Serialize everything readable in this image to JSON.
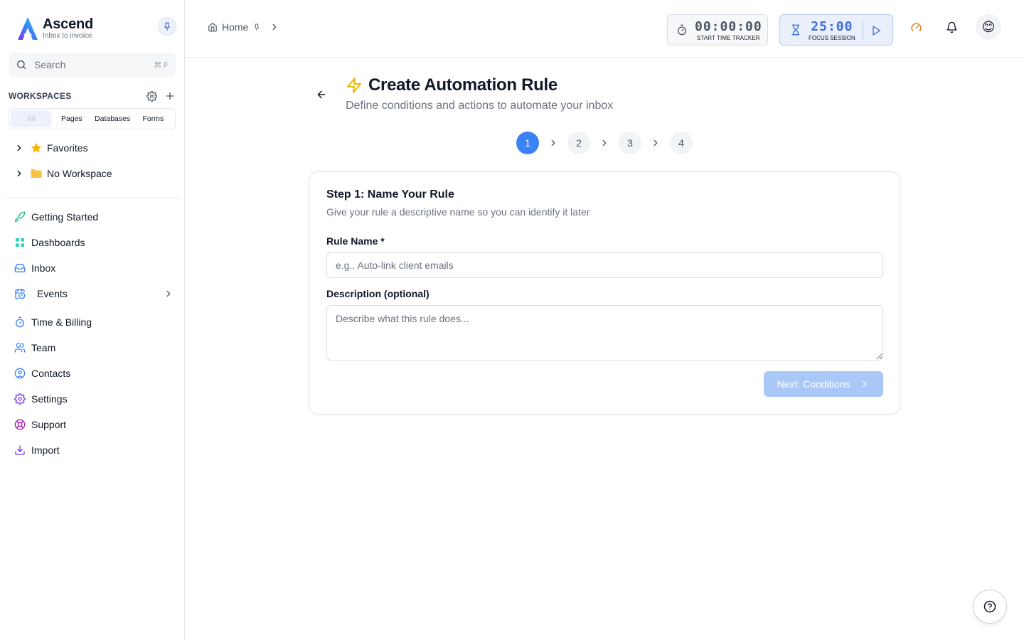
{
  "brand": {
    "name": "Ascend",
    "tagline": "Inbox to invoice"
  },
  "search": {
    "label": "Search",
    "shortcut": "⌘ F"
  },
  "workspaces": {
    "title": "WORKSPACES",
    "tabs": [
      "All",
      "Pages",
      "Databases",
      "Forms"
    ],
    "active_tab": "All",
    "tree": [
      {
        "label": "Favorites",
        "icon": "star-icon"
      },
      {
        "label": "No Workspace",
        "icon": "folder-icon"
      }
    ]
  },
  "nav": [
    {
      "label": "Getting Started",
      "icon": "rocket-icon"
    },
    {
      "label": "Dashboards",
      "icon": "dashboard-grid-icon"
    },
    {
      "label": "Inbox",
      "icon": "inbox-icon"
    },
    {
      "label": "Events",
      "icon": "calendar-clock-icon"
    },
    {
      "label": "Time & Billing",
      "icon": "stopwatch-icon"
    },
    {
      "label": "Team",
      "icon": "team-icon"
    },
    {
      "label": "Contacts",
      "icon": "contact-icon"
    },
    {
      "label": "Settings",
      "icon": "gear-icon"
    },
    {
      "label": "Support",
      "icon": "support-icon"
    },
    {
      "label": "Import",
      "icon": "download-icon"
    }
  ],
  "breadcrumb": {
    "home": "Home"
  },
  "tracker": {
    "time": "00:00:00",
    "label": "START TIME TRACKER"
  },
  "focus": {
    "time": "25:00",
    "label": "FOCUS SESSION"
  },
  "avatar": {
    "emoji": "😊"
  },
  "page": {
    "title": "Create Automation Rule",
    "subtitle": "Define conditions and actions to automate your inbox"
  },
  "stepper": {
    "steps": [
      "1",
      "2",
      "3",
      "4"
    ],
    "current": 1
  },
  "form": {
    "step_title": "Step 1: Name Your Rule",
    "step_subtitle": "Give your rule a descriptive name so you can identify it later",
    "rule_name_label": "Rule Name *",
    "rule_name_placeholder": "e.g., Auto-link client emails",
    "rule_name_value": "",
    "description_label": "Description (optional)",
    "description_placeholder": "Describe what this rule does...",
    "description_value": "",
    "next_label": "Next: Conditions"
  },
  "colors": {
    "accent": "#3b82f6",
    "accent_disabled": "#a9c8f8",
    "focus_time": "#3b6fd8",
    "lightning": "#eab308",
    "performance_icon": "#e07a14"
  }
}
